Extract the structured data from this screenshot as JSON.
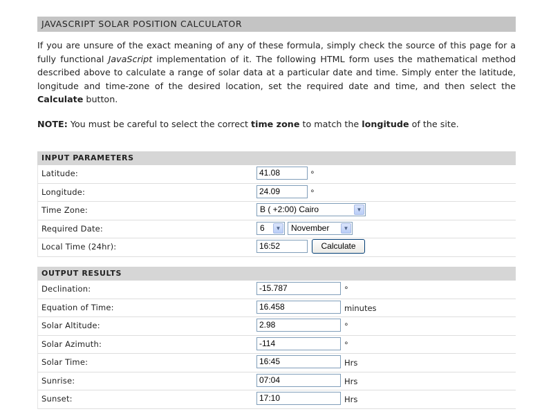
{
  "header": {
    "title": "JAVASCRIPT SOLAR POSITION CALCULATOR"
  },
  "intro": {
    "p1": "If you are unsure of the exact meaning of any of these formula, simply check the source of this page for a fully functional ",
    "p1_italic": "JavaScript",
    "p2": " implementation of it. The following HTML form uses the mathematical method described above to calculate a range of solar data at a particular date and time. Simply enter the latitude, longitude and time-zone of the desired location, set the required date and time, and then select the ",
    "p2_bold": "Calculate",
    "p3": " button."
  },
  "note": {
    "label": "NOTE:",
    "t1": " You must be careful to select the correct ",
    "b1": "time zone",
    "t2": " to match the ",
    "b2": "longitude",
    "t3": " of the site."
  },
  "input": {
    "heading": "INPUT PARAMETERS",
    "latitude": {
      "label": "Latitude:",
      "value": "41.08",
      "unit": "°"
    },
    "longitude": {
      "label": "Longitude:",
      "value": "24.09",
      "unit": "°"
    },
    "timezone": {
      "label": "Time Zone:",
      "value": "B ( +2:00) Cairo"
    },
    "date": {
      "label": "Required Date:",
      "day": "6",
      "month": "November"
    },
    "time": {
      "label": "Local Time (24hr):",
      "value": "16:52"
    },
    "calculate_label": "Calculate"
  },
  "output": {
    "heading": "OUTPUT RESULTS",
    "rows": [
      {
        "label": "Declination:",
        "value": "-15.787",
        "unit": "°"
      },
      {
        "label": "Equation of Time:",
        "value": "16.458",
        "unit": "minutes"
      },
      {
        "label": "Solar Altitude:",
        "value": "2.98",
        "unit": "°"
      },
      {
        "label": "Solar Azimuth:",
        "value": "-114",
        "unit": "°"
      },
      {
        "label": "Solar Time:",
        "value": "16:45",
        "unit": "Hrs"
      },
      {
        "label": "Sunrise:",
        "value": "07:04",
        "unit": "Hrs"
      },
      {
        "label": "Sunset:",
        "value": "17:10",
        "unit": "Hrs"
      }
    ]
  }
}
